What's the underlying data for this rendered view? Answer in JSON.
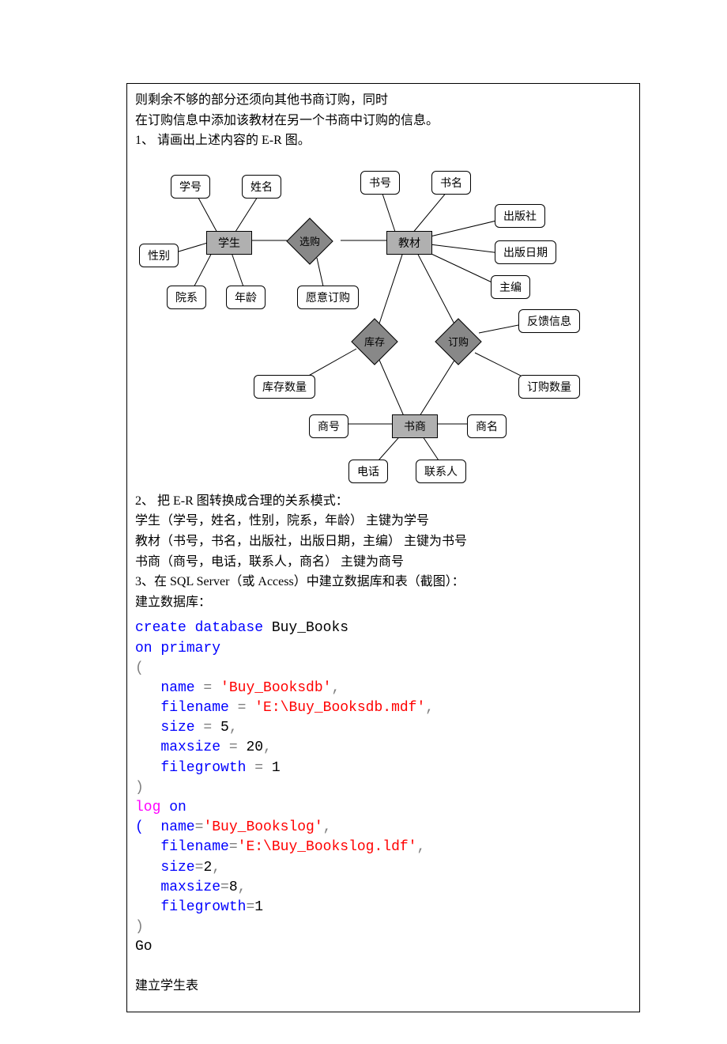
{
  "intro": {
    "line1": "则剩余不够的部分还须向其他书商订购，同时",
    "line2": "在订购信息中添加该教材在另一个书商中订购的信息。",
    "q1": "1、 请画出上述内容的 E-R 图。"
  },
  "er": {
    "entities": {
      "student": "学生",
      "textbook": "教材",
      "supplier": "书商"
    },
    "relationships": {
      "select": "选购",
      "stock": "库存",
      "order": "订购"
    },
    "attrs": {
      "sid": "学号",
      "sname": "姓名",
      "gender": "性别",
      "dept": "院系",
      "age": "年龄",
      "willorder": "愿意订购",
      "bid": "书号",
      "bname": "书名",
      "press": "出版社",
      "pubdate": "出版日期",
      "editor": "主编",
      "feedback": "反馈信息",
      "stockqty": "库存数量",
      "orderqty": "订购数量",
      "supid": "商号",
      "supname": "商名",
      "tel": "电话",
      "contact": "联系人"
    }
  },
  "q2": {
    "title": "2、 把 E-R 图转换成合理的关系模式：",
    "line1": "学生（学号，姓名，性别，院系，年龄） 主键为学号",
    "line2": " 教材（书号，书名，出版社，出版日期，主编） 主键为书号",
    "line3": "书商（商号，电话，联系人，商名） 主键为商号"
  },
  "q3": {
    "title": "3、在 SQL Server（或 Access）中建立数据库和表（截图）：",
    "subtitle": " 建立数据库：",
    "footer": "建立学生表"
  },
  "sql": {
    "t1a": "create",
    "t1b": " database",
    "t1c": " Buy_Books",
    "t2a": "on",
    "t2b": " primary",
    "t3": "(",
    "t4a": "   name ",
    "t4b": "=",
    "t4c": " 'Buy_Booksdb'",
    "t4d": ",",
    "t5a": "   filename ",
    "t5b": "=",
    "t5c": " 'E:\\Buy_Booksdb.mdf'",
    "t5d": ",",
    "t6a": "   size ",
    "t6b": "=",
    "t6c": " 5",
    "t6d": ",",
    "t7a": "   maxsize ",
    "t7b": "=",
    "t7c": " 20",
    "t7d": ",",
    "t8a": "   filegrowth ",
    "t8b": "=",
    "t8c": " 1",
    "t9": ")",
    "t10a": "log",
    "t10b": " on",
    "t11a": "(  name",
    "t11b": "=",
    "t11c": "'Buy_Bookslog'",
    "t11d": ",",
    "t12a": "   filename",
    "t12b": "=",
    "t12c": "'E:\\Buy_Bookslog.ldf'",
    "t12d": ",",
    "t13a": "   size",
    "t13b": "=",
    "t13c": "2",
    "t13d": ",",
    "t14a": "   maxsize",
    "t14b": "=",
    "t14c": "8",
    "t14d": ",",
    "t15a": "   filegrowth",
    "t15b": "=",
    "t15c": "1",
    "t16": ")",
    "t17": "Go"
  }
}
